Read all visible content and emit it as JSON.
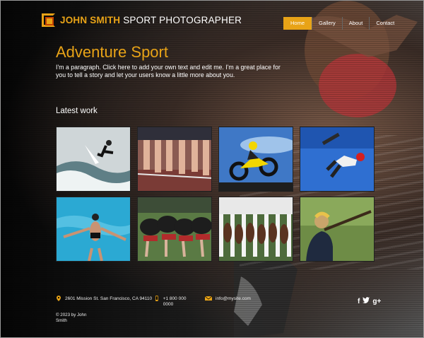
{
  "header": {
    "logo_name": "JOHN SMITH",
    "logo_title": "SPORT PHOTOGRAPHER",
    "nav": [
      {
        "label": "Home",
        "active": true
      },
      {
        "label": "Gallery",
        "active": false
      },
      {
        "label": "About",
        "active": false
      },
      {
        "label": "Contact",
        "active": false
      }
    ]
  },
  "hero": {
    "title": "Adventure Sport",
    "paragraph": "I'm a paragraph. Click here to add your own text and edit me. I'm a great place for you to tell a story and let your users know a little more about you."
  },
  "gallery": {
    "title": "Latest work",
    "items": [
      {
        "icon": "surfer-photo"
      },
      {
        "icon": "sprinters-photo"
      },
      {
        "icon": "motocross-photo"
      },
      {
        "icon": "skateboarder-photo"
      },
      {
        "icon": "swimmer-photo"
      },
      {
        "icon": "rugby-scrum-photo"
      },
      {
        "icon": "horse-race-photo"
      },
      {
        "icon": "shooter-photo"
      }
    ]
  },
  "footer": {
    "address": "2601 Mission St. San Francisco, CA 94110",
    "phone": "+1 800 000 0000",
    "email": "info@mysite.com",
    "copyright": "© 2023 by John Smith",
    "social": [
      "f",
      "t",
      "g+"
    ]
  },
  "colors": {
    "accent": "#e8a317"
  }
}
